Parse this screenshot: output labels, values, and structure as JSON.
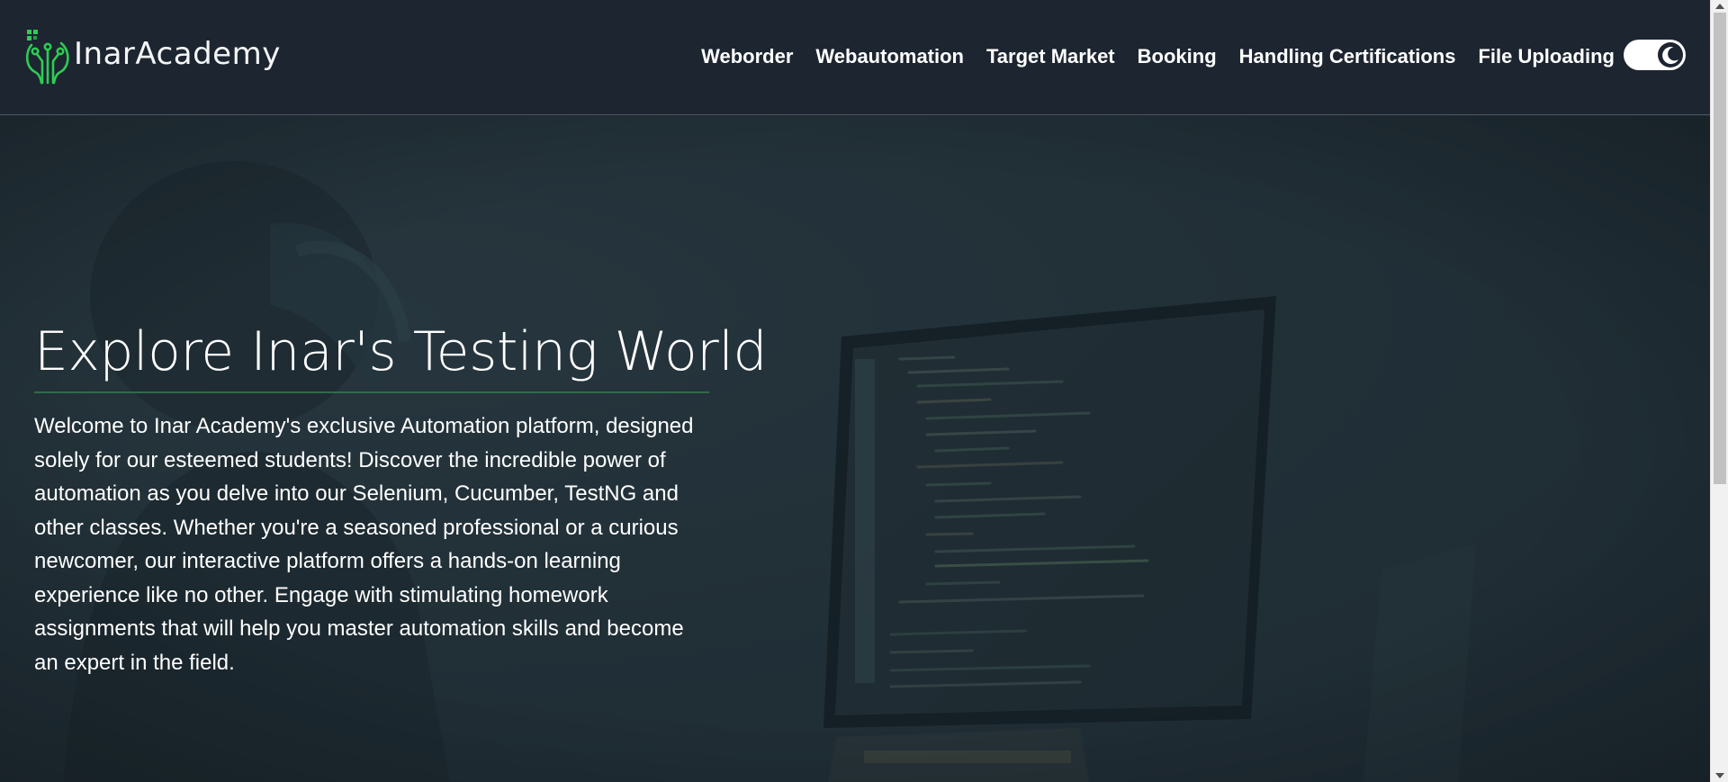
{
  "brand": {
    "name": "InarAcademy",
    "logo_icon": "circuit-tree-icon",
    "accent_color": "#2ecc55"
  },
  "nav": {
    "links": [
      "Weborder",
      "Webautomation",
      "Target Market",
      "Booking",
      "Handling Certifications",
      "File Uploading"
    ],
    "theme_toggle_icon": "moon-icon"
  },
  "hero": {
    "title": "Explore Inar's Testing World",
    "description": "Welcome to Inar Academy's exclusive Automation platform, designed solely for our esteemed students! Discover the incredible power of automation as you delve into our Selenium, Cucumber, TestNG and other classes. Whether you're a seasoned professional or a curious newcomer, our interactive platform offers a hands-on learning experience like no other. Engage with stimulating homework assignments that will help you master automation skills and become an expert in the field.",
    "background_icon": "developer-at-monitor-photo"
  },
  "colors": {
    "header_bg": "#1d2530",
    "hero_bg": "#23323a",
    "divider": "#2e6b4a",
    "text": "#ffffff"
  }
}
